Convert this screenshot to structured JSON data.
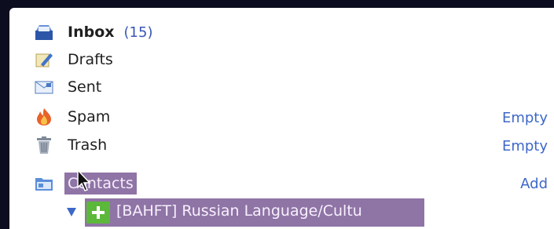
{
  "folders": [
    {
      "key": "inbox",
      "label": "Inbox",
      "count": "(15)",
      "icon": "inbox-icon"
    },
    {
      "key": "drafts",
      "label": "Drafts",
      "icon": "drafts-icon"
    },
    {
      "key": "sent",
      "label": "Sent",
      "icon": "sent-icon"
    },
    {
      "key": "spam",
      "label": "Spam",
      "action": "Empty",
      "icon": "spam-icon"
    },
    {
      "key": "trash",
      "label": "Trash",
      "action": "Empty",
      "icon": "trash-icon"
    }
  ],
  "contacts": {
    "label": "Contacts",
    "action": "Add",
    "icon": "contacts-folder-icon"
  },
  "drag_item": {
    "label": "[BAHFT] Russian Language/Cultu",
    "icon": "add-plus-icon"
  },
  "colors": {
    "link": "#3d68c8",
    "highlight": "#8f74a6",
    "count": "#3a56b8"
  }
}
